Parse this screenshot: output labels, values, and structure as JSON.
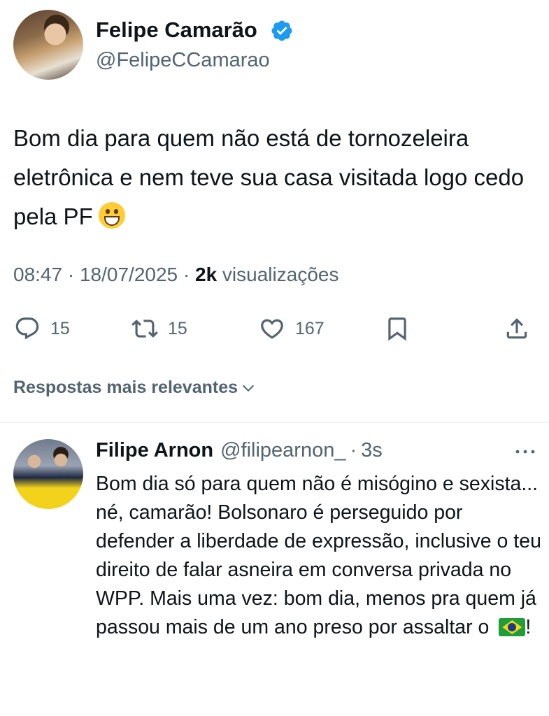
{
  "tweet": {
    "author_name": "Felipe Camarão",
    "author_handle": "@FelipeCCamarao",
    "text": "Bom dia para quem não está de tornozeleira eletrônica e nem teve sua casa visitada logo cedo pela PF",
    "emoji": "grinning-face-icon",
    "time": "08:47",
    "dot1": " · ",
    "date": "18/07/2025",
    "dot2": " · ",
    "views_count": "2k",
    "views_label": " visualizações",
    "reply_count": "15",
    "retweet_count": "15",
    "like_count": "167"
  },
  "sort": {
    "label": "Respostas mais relevantes"
  },
  "reply": {
    "author_name": "Filipe Arnon",
    "author_handle": "@filipearnon_",
    "separator": "·",
    "time": "3s",
    "text": "Bom dia só para quem não é misógino e sexista... né, camarão! Bolsonaro é perseguido por defender a liberdade de expressão, inclusive o teu direito de falar asneira em conversa privada no WPP. Mais uma vez: bom dia, menos pra quem já passou mais de um ano preso por assaltar o",
    "text_end": "!",
    "flag": "brazil-flag-icon"
  },
  "colors": {
    "text": "#0f1419",
    "secondary": "#536471",
    "verified": "#1d9bf0"
  }
}
